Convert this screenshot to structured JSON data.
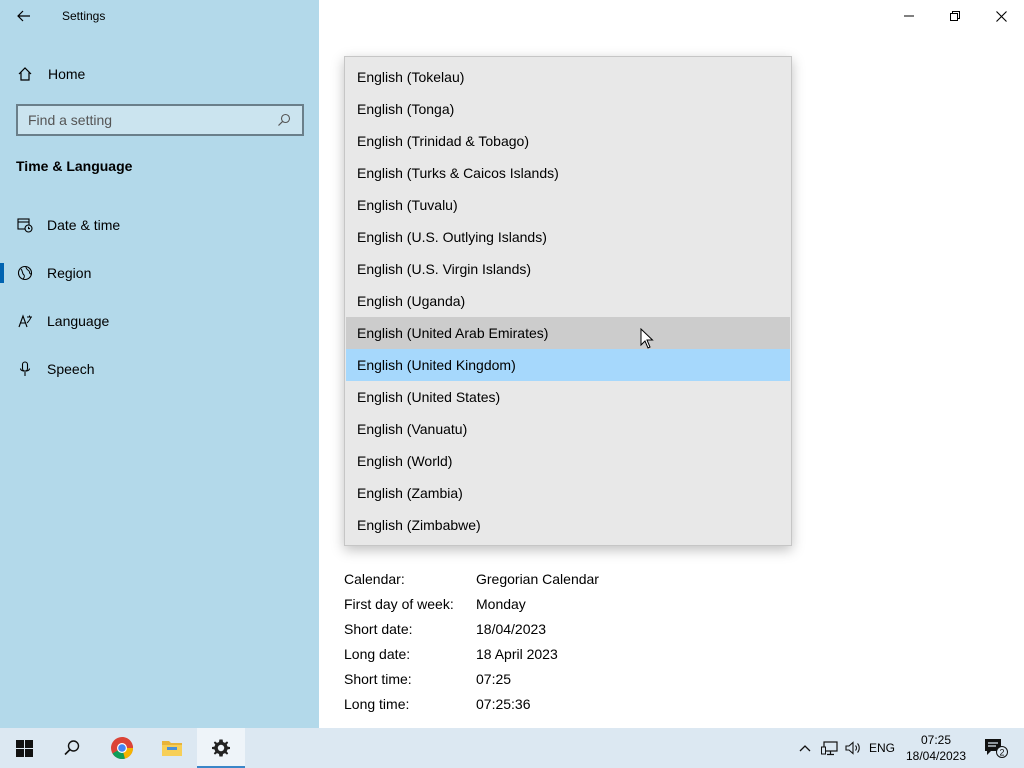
{
  "window": {
    "title": "Settings"
  },
  "sidebar": {
    "home_label": "Home",
    "search_placeholder": "Find a setting",
    "section_title": "Time & Language",
    "items": [
      {
        "label": "Date & time",
        "icon": "calendar-clock-icon"
      },
      {
        "label": "Region",
        "icon": "globe-icon"
      },
      {
        "label": "Language",
        "icon": "language-icon"
      },
      {
        "label": "Speech",
        "icon": "microphone-icon"
      }
    ]
  },
  "dropdown": {
    "options": [
      "English (Tokelau)",
      "English (Tonga)",
      "English (Trinidad & Tobago)",
      "English (Turks & Caicos Islands)",
      "English (Tuvalu)",
      "English (U.S. Outlying Islands)",
      "English (U.S. Virgin Islands)",
      "English (Uganda)",
      "English (United Arab Emirates)",
      "English (United Kingdom)",
      "English (United States)",
      "English (Vanuatu)",
      "English (World)",
      "English (Zambia)",
      "English (Zimbabwe)"
    ],
    "hovered": "English (United Arab Emirates)",
    "selected": "English (United Kingdom)"
  },
  "regional_format": [
    {
      "key": "Calendar:",
      "value": "Gregorian Calendar"
    },
    {
      "key": "First day of week:",
      "value": "Monday"
    },
    {
      "key": "Short date:",
      "value": "18/04/2023"
    },
    {
      "key": "Long date:",
      "value": "18 April 2023"
    },
    {
      "key": "Short time:",
      "value": "07:25"
    },
    {
      "key": "Long time:",
      "value": "07:25:36"
    }
  ],
  "taskbar": {
    "language": "ENG",
    "time": "07:25",
    "date": "18/04/2023",
    "notification_count": "2"
  },
  "colors": {
    "sidebar_bg": "#b3d9ea",
    "accent": "#0063b1",
    "selected_option": "#a6d8fc",
    "hover_option": "#cccccc"
  }
}
